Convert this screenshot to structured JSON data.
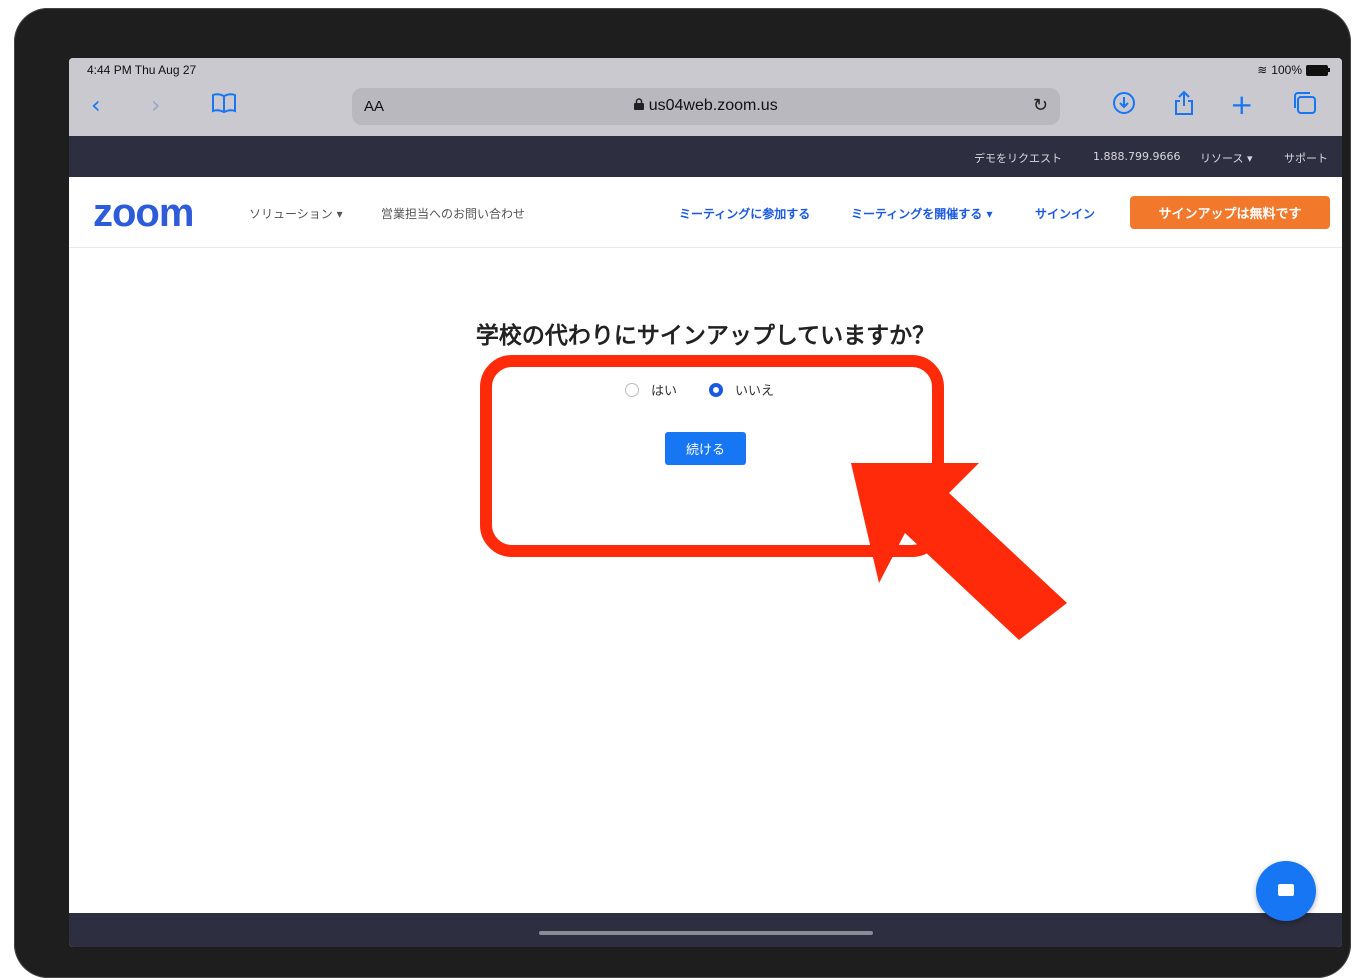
{
  "status": {
    "time": "4:44 PM  Thu Aug 27",
    "battery": "100%"
  },
  "browser": {
    "text_size_label": "AA",
    "url": "us04web.zoom.us",
    "icons": [
      "back-icon",
      "forward-icon",
      "bookmarks-icon",
      "lock-icon",
      "reload-icon",
      "download-icon",
      "share-icon",
      "new-tab-icon",
      "tabs-icon"
    ]
  },
  "topbar": {
    "demo": "デモをリクエスト",
    "phone": "1.888.799.9666",
    "resources": "リソース ▾",
    "support": "サポート"
  },
  "header": {
    "logo": "zoom",
    "solutions": "ソリューション ▾",
    "contact_sales": "営業担当へのお問い合わせ",
    "join": "ミーティングに参加する",
    "host": "ミーティングを開催する ▾",
    "signin": "サインイン",
    "signup": "サインアップは無料です"
  },
  "main": {
    "question": "学校の代わりにサインアップしていますか？",
    "options": [
      {
        "label": "はい",
        "selected": false
      },
      {
        "label": "いいえ",
        "selected": true
      }
    ],
    "continue": "続ける"
  },
  "colors": {
    "accent": "#1676f3",
    "zoom_blue": "#2d5bd9",
    "signup_orange": "#f2782c",
    "annotation_red": "#ff2a0a",
    "topbar": "#2d2e3f"
  }
}
